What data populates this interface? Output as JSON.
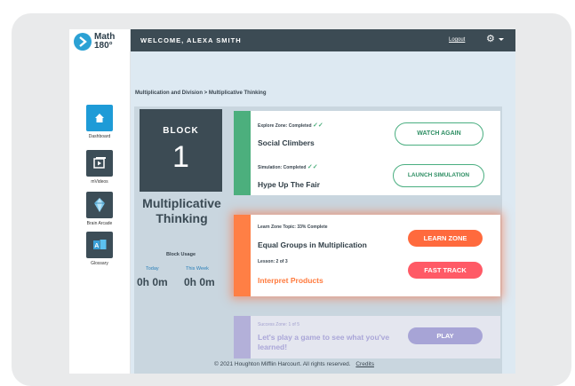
{
  "logo": {
    "line1": "Math",
    "line2": "180°"
  },
  "sidebar": {
    "items": [
      {
        "label": "Dashboard",
        "icon": "home-icon"
      },
      {
        "label": "mVideos",
        "icon": "video-icon"
      },
      {
        "label": "Brain Arcade",
        "icon": "gem-icon"
      },
      {
        "label": "Glossary",
        "icon": "glossary-icon"
      }
    ]
  },
  "header": {
    "welcome": "WELCOME, ALEXA SMITH",
    "logout": "Logout"
  },
  "breadcrumb": "Multiplication and Division > Multiplicative Thinking",
  "block": {
    "label": "BLOCK",
    "number": "1",
    "title": "Multiplicative Thinking",
    "usage_title": "Block Usage",
    "today_label": "Today",
    "week_label": "This Week",
    "today_value": "0h 0m",
    "week_value": "0h 0m"
  },
  "explore": {
    "zone_label": "Explore Zone: Completed",
    "title": "Social Climbers",
    "button": "WATCH AGAIN",
    "sim_label": "Simulation: Completed",
    "sim_title": "Hype Up The Fair",
    "sim_button": "LAUNCH SIMULATION"
  },
  "learn": {
    "topic_label": "Learn Zone Topic: 33% Complete",
    "title": "Equal Groups in Multiplication",
    "button": "LEARN ZONE",
    "lesson_label": "Lesson: 2 of 3",
    "lesson_title": "Interpret Products",
    "fast_button": "FAST TRACK"
  },
  "success": {
    "zone_label": "Success Zone: 1 of 5",
    "text": "Let's play a game to see what you've learned!",
    "button": "PLAY"
  },
  "footer": {
    "text": "2021 Houghton Mifflin Harcourt. All rights reserved.",
    "credits": "Credits"
  },
  "colors": {
    "explore_green": "#4caf7d",
    "learn_orange": "#ff7f45",
    "learn_button": "#ff6a3d",
    "fast_button": "#ff5a66",
    "success_purple": "#b3b0d9",
    "header_dark": "#3c4b54",
    "accent_blue": "#1e9bd7"
  }
}
